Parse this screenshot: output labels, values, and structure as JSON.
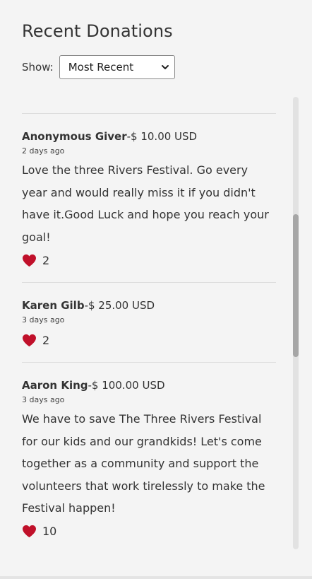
{
  "header": {
    "title": "Recent Donations",
    "show_label": "Show:",
    "sort_selected": "Most Recent"
  },
  "donations": [
    {
      "donor": "Anonymous Giver",
      "amount": "-$ 10.00 USD",
      "date": "2 days ago",
      "message": "Love the three Rivers Festival. Go every year and would really miss it if you didn't have it.Good Luck and hope you reach your goal!",
      "likes": "2"
    },
    {
      "donor": "Karen Gilb",
      "amount": "-$ 25.00 USD",
      "date": "3 days ago",
      "message": "",
      "likes": "2"
    },
    {
      "donor": "Aaron King",
      "amount": "-$ 100.00 USD",
      "date": "3 days ago",
      "message": "We have to save The Three Rivers Festival for our kids and our grandkids! Let's come together as a community and support the volunteers that work tirelessly to make the Festival happen!",
      "likes": "10"
    }
  ],
  "colors": {
    "heart": "#c0102a",
    "background": "#f4f4f4",
    "scroll_thumb": "#a6a6a6"
  },
  "icons": {
    "like": "heart-icon",
    "dropdown": "chevron-down-icon"
  },
  "scroll": {
    "position_fraction": 0.26
  }
}
